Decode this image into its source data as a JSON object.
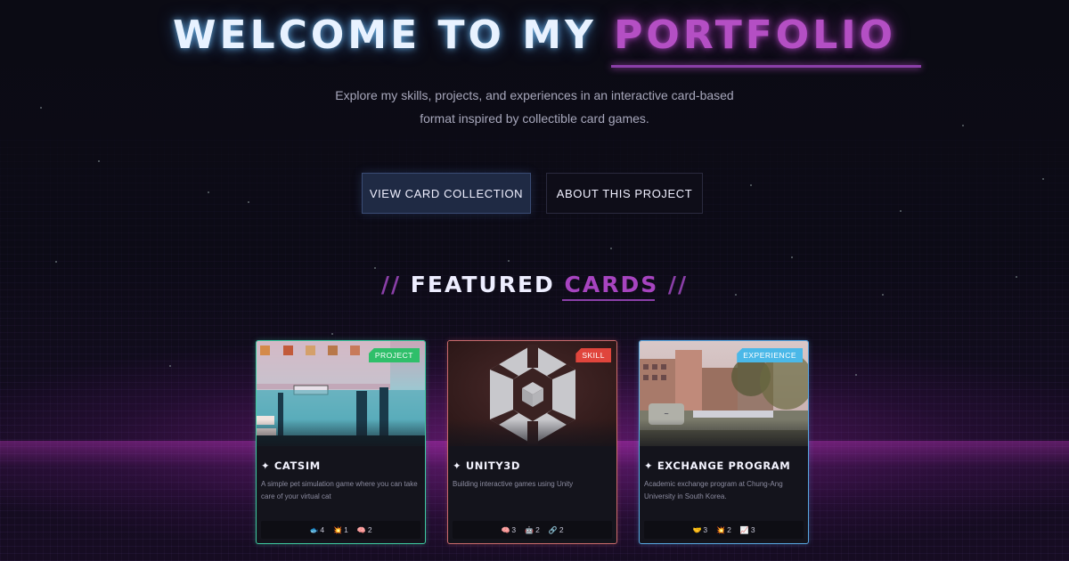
{
  "hero": {
    "title_main": "WELCOME TO MY ",
    "title_accent": "PORTFOLIO",
    "subtitle": "Explore my skills, projects, and experiences in an interactive card-based format inspired by collectible card games."
  },
  "buttons": {
    "primary": "VIEW CARD COLLECTION",
    "secondary": "ABOUT THIS PROJECT"
  },
  "section": {
    "slash_left": "//",
    "title_main": "FEATURED ",
    "title_accent": "CARDS",
    "slash_right": "//"
  },
  "cards": [
    {
      "badge": "PROJECT",
      "badge_color": "#2fbf6a",
      "title": "✦ CATSIM",
      "description": "A simple pet simulation game where you can take care of your virtual cat",
      "stats": [
        {
          "icon": "🐟",
          "value": "4"
        },
        {
          "icon": "💥",
          "value": "1"
        },
        {
          "icon": "🧠",
          "value": "2"
        }
      ]
    },
    {
      "badge": "SKILL",
      "badge_color": "#e0453c",
      "title": "✦ UNITY3D",
      "description": "Building interactive games using Unity",
      "stats": [
        {
          "icon": "🧠",
          "value": "3"
        },
        {
          "icon": "🤖",
          "value": "2"
        },
        {
          "icon": "🔗",
          "value": "2"
        }
      ]
    },
    {
      "badge": "EXPERIENCE",
      "badge_color": "#4ab8e8",
      "title": "✦ EXCHANGE PROGRAM",
      "description": "Academic exchange program at Chung-Ang University in South Korea.",
      "stats": [
        {
          "icon": "🤝",
          "value": "3"
        },
        {
          "icon": "💥",
          "value": "2"
        },
        {
          "icon": "📈",
          "value": "3"
        }
      ]
    }
  ],
  "colors": {
    "accent_purple": "#b44fc4",
    "title_glow": "#e8f2ff",
    "project_border": "#3ec9a0",
    "skill_border": "#c86a6a",
    "experience_border": "#58a6e0"
  }
}
